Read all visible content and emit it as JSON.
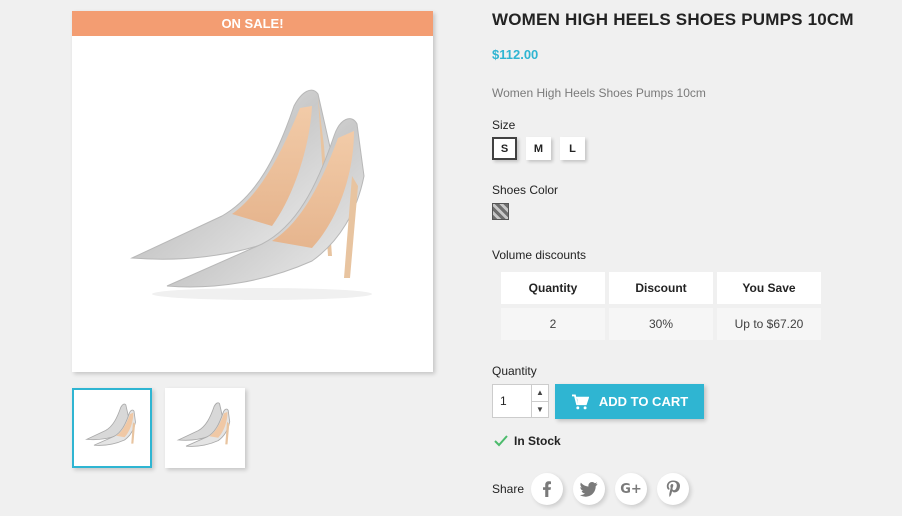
{
  "gallery": {
    "sale_flag": "On sale!",
    "main_image_alt": "shoe-photo",
    "thumbnails": [
      "shoe-thumb-1",
      "shoe-thumb-2"
    ]
  },
  "product": {
    "title": "WOMEN HIGH HEELS SHOES PUMPS 10CM",
    "price": "$112.00",
    "short_description": "Women High Heels Shoes Pumps 10cm"
  },
  "variants": {
    "size_label": "Size",
    "sizes": [
      "S",
      "M",
      "L"
    ],
    "selected_size": "S",
    "color_label": "Shoes Color",
    "swatch_color": "#9a9a9a"
  },
  "discounts": {
    "label": "Volume discounts",
    "headers": [
      "Quantity",
      "Discount",
      "You Save"
    ],
    "rows": [
      [
        "2",
        "30%",
        "Up to $67.20"
      ]
    ]
  },
  "purchase": {
    "quantity_label": "Quantity",
    "quantity_value": "1",
    "add_to_cart_label": "Add to cart",
    "stock_label": "In Stock"
  },
  "share": {
    "label": "Share",
    "networks": [
      "facebook-icon",
      "twitter-icon",
      "google-plus-icon",
      "pinterest-icon"
    ]
  },
  "colors": {
    "accent": "#2fb5d2",
    "sale": "#f39d72",
    "stock_check": "#4cbb6c"
  }
}
